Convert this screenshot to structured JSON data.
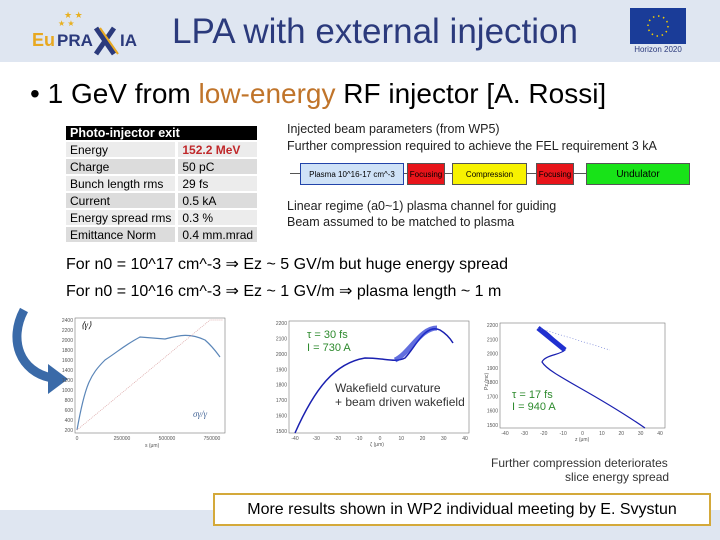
{
  "header": {
    "title": "LPA with external injection",
    "logo_text": "EuPRAXIA",
    "eu_label": "Horizon 2020"
  },
  "bullet": {
    "mark": "•",
    "pre": "1 GeV from ",
    "highlight": "low-energy",
    "post": " RF injector [A. Rossi]"
  },
  "table": {
    "title": "Photo-injector exit",
    "rows": [
      {
        "label": "Energy",
        "value": "152.2 MeV"
      },
      {
        "label": "Charge",
        "value": "50 pC"
      },
      {
        "label": "Bunch length rms",
        "value": "29 fs"
      },
      {
        "label": "Current",
        "value": "0.5 kA"
      },
      {
        "label": "Energy spread rms",
        "value": "0.3 %"
      },
      {
        "label": "Emittance Norm",
        "value": "0.4 mm.mrad"
      }
    ]
  },
  "notes": {
    "line1": "Injected beam parameters (from WP5)",
    "line2": "Further compression required to achieve the FEL requirement 3 kA",
    "line3": "Linear regime (a0~1) plasma channel for guiding",
    "line4": "Beam assumed to be matched to plasma"
  },
  "diagram": {
    "plasma": "Plasma 10^16-17 cm^-3",
    "focusing1": "Focusing",
    "compression": "Compression",
    "focusing2": "Focusing",
    "undulator": "Undulator",
    "colors": {
      "plasma": "#cfe2f7",
      "focusing": "#e8141a",
      "compression": "#f7f200",
      "undulator": "#18e318"
    }
  },
  "results": {
    "line1": "For n0 = 10^17 cm^-3 ⇒ Ez ~ 5 GV/m but huge energy spread",
    "line2": "For n0 = 10^16 cm^-3 ⇒ Ez ~ 1 GV/m ⇒ plasma length ~ 1 m"
  },
  "plot1": {
    "ylabel": "⟨γ⟩",
    "y2label": "σγ/γ",
    "xlabel": "s (μm)",
    "yticks": [
      "2400",
      "2200",
      "2000",
      "1800",
      "1600",
      "1400",
      "1200",
      "1000",
      "800",
      "600",
      "400",
      "200"
    ],
    "xticks": [
      "0",
      "250000",
      "500000",
      "750000"
    ]
  },
  "plot2": {
    "tau": "τ = 30 fs",
    "current": "I = 730 A",
    "xlabel": "ζ (μm)",
    "yticks": [
      "2200",
      "2100",
      "2000",
      "1900",
      "1800",
      "1700",
      "1600",
      "1500"
    ],
    "xticks": [
      "-40",
      "-30",
      "-20",
      "-10",
      "0",
      "10",
      "20",
      "30",
      "40"
    ],
    "caption1": "Wakefield curvature",
    "caption2": "+ beam driven wakefield"
  },
  "plot3": {
    "tau": "τ = 17 fs",
    "current": "I = 940 A",
    "ylabel": "Pz (mc)",
    "xlabel": "z (μm)",
    "yticks": [
      "2200",
      "2100",
      "2000",
      "1900",
      "1800",
      "1700",
      "1600",
      "1500"
    ],
    "xticks": [
      "-40",
      "-30",
      "-20",
      "-10",
      "0",
      "10",
      "20",
      "30",
      "40"
    ],
    "caption1": "Further compression deteriorates",
    "caption2": "slice energy spread"
  },
  "footer_note": "More results shown in WP2 individual meeting by E. Svystun"
}
